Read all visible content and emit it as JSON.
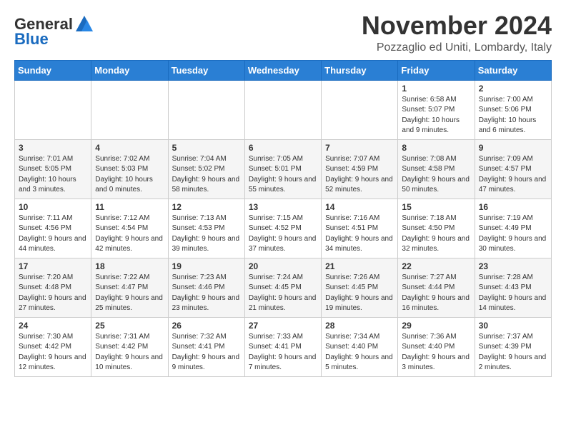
{
  "logo": {
    "text_general": "General",
    "text_blue": "Blue"
  },
  "header": {
    "month_title": "November 2024",
    "location": "Pozzaglio ed Uniti, Lombardy, Italy"
  },
  "weekdays": [
    "Sunday",
    "Monday",
    "Tuesday",
    "Wednesday",
    "Thursday",
    "Friday",
    "Saturday"
  ],
  "weeks": [
    [
      {
        "day": "",
        "info": ""
      },
      {
        "day": "",
        "info": ""
      },
      {
        "day": "",
        "info": ""
      },
      {
        "day": "",
        "info": ""
      },
      {
        "day": "",
        "info": ""
      },
      {
        "day": "1",
        "info": "Sunrise: 6:58 AM\nSunset: 5:07 PM\nDaylight: 10 hours and 9 minutes."
      },
      {
        "day": "2",
        "info": "Sunrise: 7:00 AM\nSunset: 5:06 PM\nDaylight: 10 hours and 6 minutes."
      }
    ],
    [
      {
        "day": "3",
        "info": "Sunrise: 7:01 AM\nSunset: 5:05 PM\nDaylight: 10 hours and 3 minutes."
      },
      {
        "day": "4",
        "info": "Sunrise: 7:02 AM\nSunset: 5:03 PM\nDaylight: 10 hours and 0 minutes."
      },
      {
        "day": "5",
        "info": "Sunrise: 7:04 AM\nSunset: 5:02 PM\nDaylight: 9 hours and 58 minutes."
      },
      {
        "day": "6",
        "info": "Sunrise: 7:05 AM\nSunset: 5:01 PM\nDaylight: 9 hours and 55 minutes."
      },
      {
        "day": "7",
        "info": "Sunrise: 7:07 AM\nSunset: 4:59 PM\nDaylight: 9 hours and 52 minutes."
      },
      {
        "day": "8",
        "info": "Sunrise: 7:08 AM\nSunset: 4:58 PM\nDaylight: 9 hours and 50 minutes."
      },
      {
        "day": "9",
        "info": "Sunrise: 7:09 AM\nSunset: 4:57 PM\nDaylight: 9 hours and 47 minutes."
      }
    ],
    [
      {
        "day": "10",
        "info": "Sunrise: 7:11 AM\nSunset: 4:56 PM\nDaylight: 9 hours and 44 minutes."
      },
      {
        "day": "11",
        "info": "Sunrise: 7:12 AM\nSunset: 4:54 PM\nDaylight: 9 hours and 42 minutes."
      },
      {
        "day": "12",
        "info": "Sunrise: 7:13 AM\nSunset: 4:53 PM\nDaylight: 9 hours and 39 minutes."
      },
      {
        "day": "13",
        "info": "Sunrise: 7:15 AM\nSunset: 4:52 PM\nDaylight: 9 hours and 37 minutes."
      },
      {
        "day": "14",
        "info": "Sunrise: 7:16 AM\nSunset: 4:51 PM\nDaylight: 9 hours and 34 minutes."
      },
      {
        "day": "15",
        "info": "Sunrise: 7:18 AM\nSunset: 4:50 PM\nDaylight: 9 hours and 32 minutes."
      },
      {
        "day": "16",
        "info": "Sunrise: 7:19 AM\nSunset: 4:49 PM\nDaylight: 9 hours and 30 minutes."
      }
    ],
    [
      {
        "day": "17",
        "info": "Sunrise: 7:20 AM\nSunset: 4:48 PM\nDaylight: 9 hours and 27 minutes."
      },
      {
        "day": "18",
        "info": "Sunrise: 7:22 AM\nSunset: 4:47 PM\nDaylight: 9 hours and 25 minutes."
      },
      {
        "day": "19",
        "info": "Sunrise: 7:23 AM\nSunset: 4:46 PM\nDaylight: 9 hours and 23 minutes."
      },
      {
        "day": "20",
        "info": "Sunrise: 7:24 AM\nSunset: 4:45 PM\nDaylight: 9 hours and 21 minutes."
      },
      {
        "day": "21",
        "info": "Sunrise: 7:26 AM\nSunset: 4:45 PM\nDaylight: 9 hours and 19 minutes."
      },
      {
        "day": "22",
        "info": "Sunrise: 7:27 AM\nSunset: 4:44 PM\nDaylight: 9 hours and 16 minutes."
      },
      {
        "day": "23",
        "info": "Sunrise: 7:28 AM\nSunset: 4:43 PM\nDaylight: 9 hours and 14 minutes."
      }
    ],
    [
      {
        "day": "24",
        "info": "Sunrise: 7:30 AM\nSunset: 4:42 PM\nDaylight: 9 hours and 12 minutes."
      },
      {
        "day": "25",
        "info": "Sunrise: 7:31 AM\nSunset: 4:42 PM\nDaylight: 9 hours and 10 minutes."
      },
      {
        "day": "26",
        "info": "Sunrise: 7:32 AM\nSunset: 4:41 PM\nDaylight: 9 hours and 9 minutes."
      },
      {
        "day": "27",
        "info": "Sunrise: 7:33 AM\nSunset: 4:41 PM\nDaylight: 9 hours and 7 minutes."
      },
      {
        "day": "28",
        "info": "Sunrise: 7:34 AM\nSunset: 4:40 PM\nDaylight: 9 hours and 5 minutes."
      },
      {
        "day": "29",
        "info": "Sunrise: 7:36 AM\nSunset: 4:40 PM\nDaylight: 9 hours and 3 minutes."
      },
      {
        "day": "30",
        "info": "Sunrise: 7:37 AM\nSunset: 4:39 PM\nDaylight: 9 hours and 2 minutes."
      }
    ]
  ]
}
